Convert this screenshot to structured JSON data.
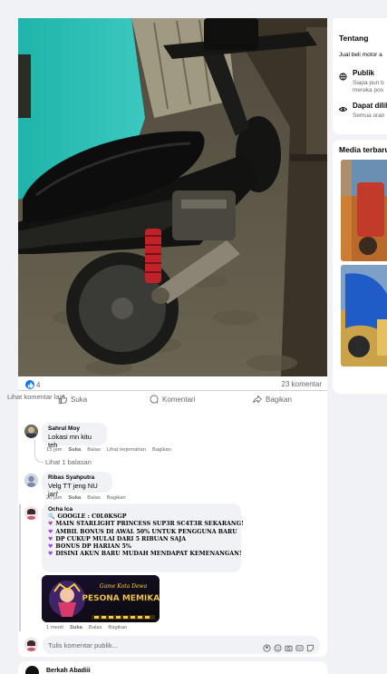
{
  "post": {
    "reactions_count": "4",
    "comments_count": "23 komentar",
    "actions": {
      "like": "Suka",
      "comment": "Komentari",
      "share": "Bagikan"
    },
    "see_more_comments": "Lihat komentar lain"
  },
  "comments": [
    {
      "name": "Sahrul Moy",
      "text": "Lokasi mn kitu teh",
      "time": "15 jam",
      "like": "Suka",
      "reply": "Balas",
      "translate": "Lihat terjemahan",
      "share": "Bagikan",
      "replies_link": "Lihat 1 balasan"
    },
    {
      "name": "Ribas Syahputra",
      "text": "Velg TT jeng NU jari'",
      "time": "20 jam",
      "like": "Suka",
      "reply": "Balas",
      "share": "Bagikan"
    },
    {
      "name": "Ocha Ica",
      "lines": [
        "GOOGLE : C0L0KSGP",
        "MAIN STARLIGHT PRINCESS SUP3R SC4T3R SEKARANG!",
        "AMBIL BONUS DI AWAL 50% UNTUK PENGGUNA BARU",
        "DP CUKUP MULAI DARI 5 RIBUAN SAJA",
        "BONUS DP HARIAN 5%",
        "DISINI AKUN BARU MUDAH MENDAPAT KEMENANGAN!"
      ],
      "time": "1 menit",
      "like": "Suka",
      "reply": "Balas",
      "share": "Bagikan",
      "promo_image_text": {
        "top": "Game Kota Dewa",
        "main": "PESONA MEMIKAT"
      }
    }
  ],
  "composer": {
    "placeholder": "Tulis komentar publik..."
  },
  "next_post": {
    "author": "Berkah Abadiii"
  },
  "sidebar": {
    "about": {
      "title": "Tentang",
      "description": "Jual beli motor a",
      "privacy_title": "Publik",
      "privacy_desc_1": "Siapa pun b",
      "privacy_desc_2": "mereka pos",
      "visibility_title": "Dapat dilih",
      "visibility_desc": "Semua oran"
    },
    "media": {
      "title": "Media terbaru"
    }
  },
  "colors": {
    "accent": "#1877f2",
    "background": "#f0f2f5",
    "spam_heart": "#a04bd0"
  }
}
